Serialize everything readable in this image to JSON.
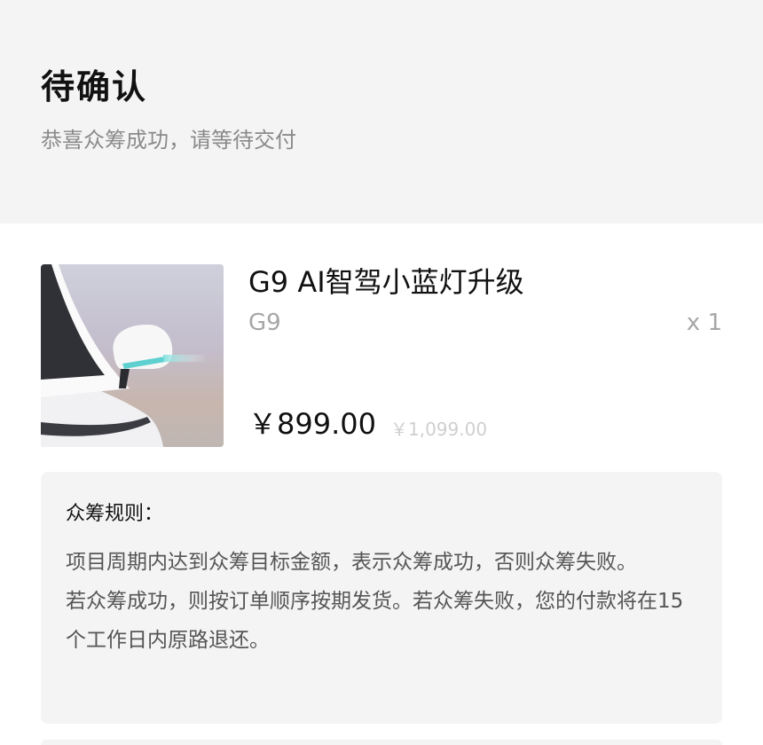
{
  "status": {
    "title": "待确认",
    "subtitle": "恭喜众筹成功，请等待交付"
  },
  "product": {
    "name": "G9 AI智驾小蓝灯升级",
    "variant": "G9",
    "quantity": "x 1",
    "price": "￥899.00",
    "original_price": "￥1,099.00",
    "image_icon": "car-mirror-blue-light-image"
  },
  "rules": {
    "heading": "众筹规则：",
    "paragraphs": [
      "项目周期内达到众筹目标金额，表示众筹成功，否则众筹失败。",
      "若众筹成功，则按订单顺序按期发货。若众筹失败，您的付款将在15个工作日内原路退还。"
    ]
  },
  "colors": {
    "header_bg": "#f4f4f4",
    "rules_bg": "#f4f4f4",
    "accent_light": "#5ed0cf"
  }
}
